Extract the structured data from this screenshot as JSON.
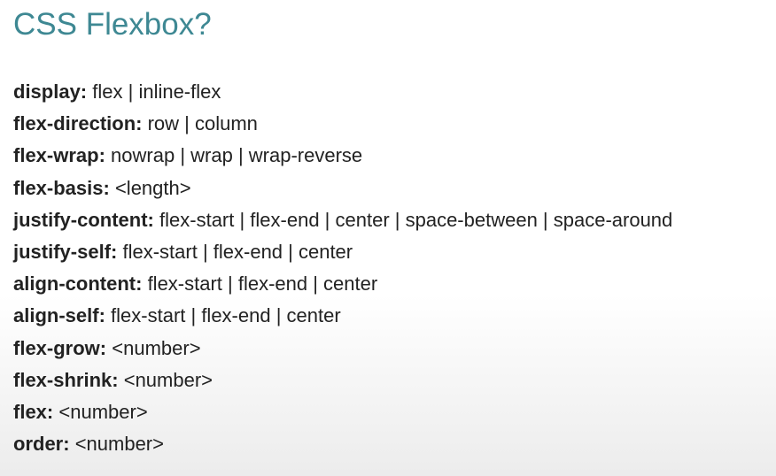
{
  "title": "CSS Flexbox?",
  "properties": [
    {
      "name": "display:",
      "values": "flex | inline-flex"
    },
    {
      "name": "flex-direction:",
      "values": "row | column"
    },
    {
      "name": "flex-wrap:",
      "values": "nowrap | wrap | wrap-reverse"
    },
    {
      "name": "flex-basis:",
      "values": "<length>"
    },
    {
      "name": "justify-content:",
      "values": "flex-start | flex-end | center | space-between | space-around"
    },
    {
      "name": "justify-self:",
      "values": "flex-start | flex-end | center"
    },
    {
      "name": "align-content:",
      "values": "flex-start | flex-end | center"
    },
    {
      "name": "align-self:",
      "values": "flex-start | flex-end | center"
    },
    {
      "name": "flex-grow:",
      "values": "<number>"
    },
    {
      "name": "flex-shrink:",
      "values": "<number>"
    },
    {
      "name": "flex:",
      "values": "<number>"
    },
    {
      "name": "order:",
      "values": "<number>"
    }
  ]
}
